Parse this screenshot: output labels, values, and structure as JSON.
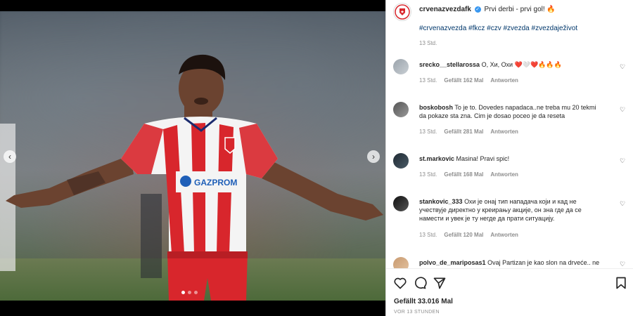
{
  "post": {
    "username": "crvenazvezdafk",
    "caption": "Prvi derbi - prvi gol! 🔥",
    "hashtags": "#crvenazvezda #fkcz #czv #zvezda #zvezdaježivot",
    "time": "13 Std.",
    "likes": "Gefällt 33.016 Mal",
    "posted_ago": "VOR 13 STUNDEN"
  },
  "comments": [
    {
      "user": "srecko__stellarossa",
      "text": "О, Хи, Охи ❤️🤍❤️🔥🔥🔥",
      "time": "13 Std.",
      "likes": "Gefällt 162 Mal",
      "reply": "Antworten"
    },
    {
      "user": "boskobosh",
      "text": "To je to. Dovedes napadaca..ne treba mu 20 tekmi da pokaze sta zna. Cim je dosao poceo je da reseta",
      "time": "13 Std.",
      "likes": "Gefällt 281 Mal",
      "reply": "Antworten"
    },
    {
      "user": "st.markovic",
      "text": "Masina! Pravi spic!",
      "time": "13 Std.",
      "likes": "Gefällt 168 Mal",
      "reply": "Antworten"
    },
    {
      "user": "stankovic_333",
      "text": "Охи је онај тип нападача који и кад не учествује директно у креирању акције, он зна где да се намести и увек је ту негде да прати ситуацију.",
      "time": "13 Std.",
      "likes": "Gefällt 120 Mal",
      "reply": "Antworten"
    },
    {
      "user": "polvo_de_mariposas1",
      "text": "Ovaj Partizan je kao slon na drveće.. ne"
    }
  ],
  "jersey": {
    "sponsor": "GAZPROM"
  },
  "colors": {
    "jersey_red": "#d8262c",
    "link_blue": "#00376b",
    "verified_blue": "#3897f0"
  }
}
